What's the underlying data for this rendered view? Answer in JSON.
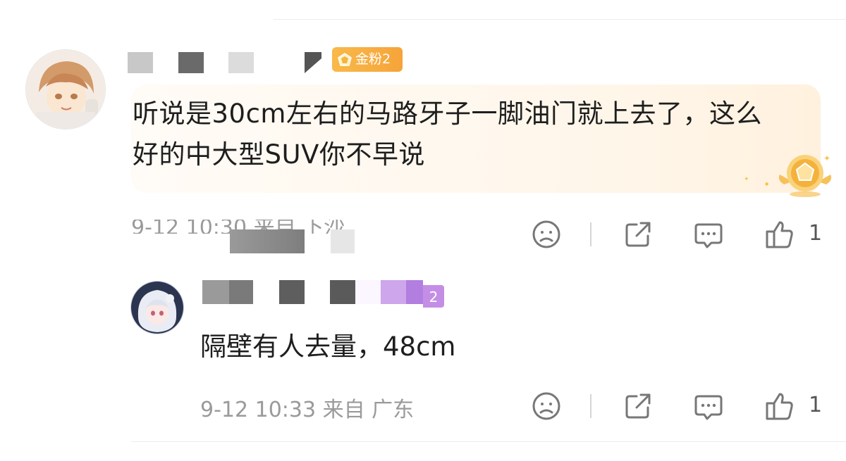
{
  "comment": {
    "badge_label": "金粉2",
    "text": "听说是30cm左右的马路牙子一脚油门就上去了，这么好的中大型SUV你不早说",
    "meta_partial": "9-12 10:30 来自 下沙",
    "like_count": "1",
    "icons": [
      "frown-icon",
      "share-icon",
      "comment-icon",
      "thumbs-up-icon"
    ]
  },
  "reply": {
    "badge_level": "2",
    "text": "隔壁有人去量，48cm",
    "meta": "9-12 10:33 来自 广东",
    "like_count": "1",
    "icons": [
      "frown-icon",
      "share-icon",
      "comment-icon",
      "thumbs-up-icon"
    ]
  },
  "colors": {
    "gold_badge": "#f7ae40",
    "bubble": "#fff6ea",
    "purple_badge": "#c58ee6",
    "meta_text": "#9a9a9a"
  }
}
